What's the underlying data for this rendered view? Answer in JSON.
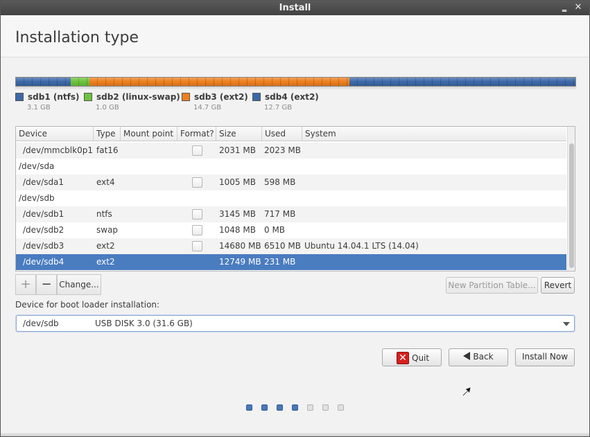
{
  "window": {
    "title": "Install"
  },
  "page": {
    "title": "Installation type"
  },
  "partition_bar": [
    {
      "label": "sdb1 (ntfs)",
      "size": "3.1 GB",
      "color": "#3c68a8",
      "fraction": 0.0985
    },
    {
      "label": "sdb2 (linux-swap)",
      "size": "1.0 GB",
      "color": "#6cc33c",
      "fraction": 0.0325
    },
    {
      "label": "sdb3 (ext2)",
      "size": "14.7 GB",
      "color": "#ee7f1e",
      "fraction": 0.4655
    },
    {
      "label": "sdb4 (ext2)",
      "size": "12.7 GB",
      "color": "#3c68a8",
      "fraction": 0.4035
    }
  ],
  "table": {
    "headers": [
      "Device",
      "Type",
      "Mount point",
      "Format?",
      "Size",
      "Used",
      "System"
    ],
    "rows": [
      {
        "device": "/dev/mmcblk0p1",
        "type": "fat16",
        "mount": "",
        "format": true,
        "size": "2031 MB",
        "used": "2023 MB",
        "system": "",
        "indent": true
      },
      {
        "device": "/dev/sda",
        "type": "",
        "mount": "",
        "format": false,
        "size": "",
        "used": "",
        "system": "",
        "indent": false
      },
      {
        "device": "/dev/sda1",
        "type": "ext4",
        "mount": "",
        "format": true,
        "size": "1005 MB",
        "used": "598 MB",
        "system": "",
        "indent": true
      },
      {
        "device": "/dev/sdb",
        "type": "",
        "mount": "",
        "format": false,
        "size": "",
        "used": "",
        "system": "",
        "indent": false
      },
      {
        "device": "/dev/sdb1",
        "type": "ntfs",
        "mount": "",
        "format": true,
        "size": "3145 MB",
        "used": "717 MB",
        "system": "",
        "indent": true
      },
      {
        "device": "/dev/sdb2",
        "type": "swap",
        "mount": "",
        "format": true,
        "size": "1048 MB",
        "used": "0 MB",
        "system": "",
        "indent": true
      },
      {
        "device": "/dev/sdb3",
        "type": "ext2",
        "mount": "",
        "format": true,
        "size": "14680 MB",
        "used": "6510 MB",
        "system": "Ubuntu 14.04.1 LTS (14.04)",
        "indent": true
      },
      {
        "device": "/dev/sdb4",
        "type": "ext2",
        "mount": "",
        "format": false,
        "size": "12749 MB",
        "used": "231 MB",
        "system": "",
        "indent": true,
        "selected": true
      }
    ]
  },
  "toolbar": {
    "add_label": "+",
    "remove_label": "−",
    "change_label": "Change...",
    "new_table_label": "New Partition Table...",
    "revert_label": "Revert"
  },
  "boot_loader": {
    "label": "Device for boot loader installation:",
    "device": "/dev/sdb",
    "description": "USB DISK 3.0 (31.6 GB)"
  },
  "buttons": {
    "quit_label": "Quit",
    "back_label": "Back",
    "install_label": "Install Now"
  },
  "progress": {
    "total_steps": 7,
    "completed_steps": 4
  }
}
